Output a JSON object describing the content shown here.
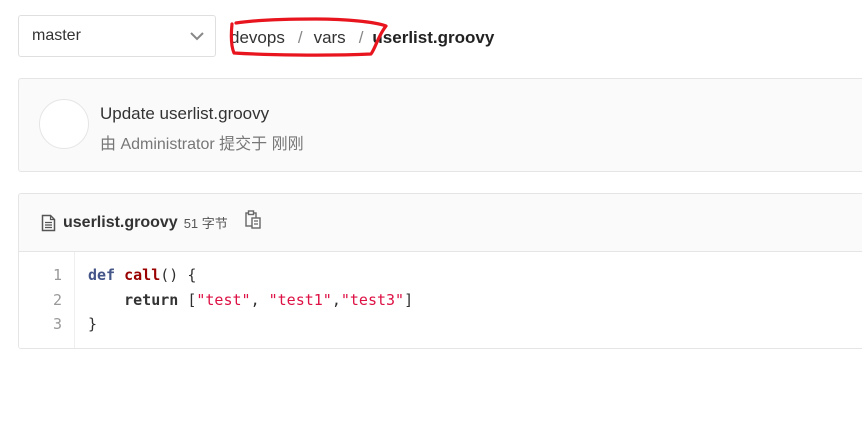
{
  "branch": {
    "selected": "master"
  },
  "breadcrumb": {
    "parts": [
      "devops",
      "vars"
    ],
    "separator": "/",
    "file": "userlist.groovy"
  },
  "commit": {
    "title": "Update userlist.groovy",
    "meta": "由 Administrator 提交于 刚刚"
  },
  "file": {
    "name": "userlist.groovy",
    "size": "51 字节",
    "line_numbers": [
      "1",
      "2",
      "3"
    ],
    "code": {
      "l1_kw": "def",
      "l1_fn": "call",
      "l1_rest": "() {",
      "l2_indent": "    ",
      "l2_kw": "return",
      "l2_open": " [",
      "l2_s1": "\"test\"",
      "l2_c1": ", ",
      "l2_s2": "\"test1\"",
      "l2_c2": ",",
      "l2_s3": "\"test3\"",
      "l2_close": "]",
      "l3": "}"
    }
  },
  "colors": {
    "annotation": "#e8141e",
    "string": "#dd1144",
    "function": "#990000",
    "keyword": "#445588"
  },
  "icons": [
    "chevron-down-icon",
    "file-icon",
    "copy-icon"
  ]
}
